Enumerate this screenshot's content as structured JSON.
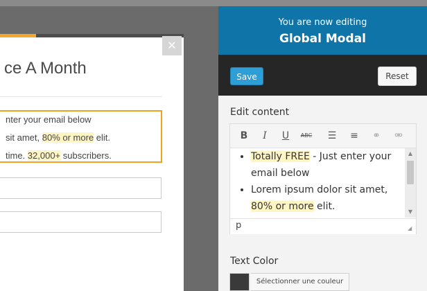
{
  "modal": {
    "title": "ce A Month",
    "close_glyph": "✕",
    "lines": [
      {
        "before": "nter your email below",
        "highlight": "",
        "after": ""
      },
      {
        "before": "sit amet, ",
        "highlight": "80% or more",
        "after": " elit."
      },
      {
        "before": "time. ",
        "highlight": "32,000+",
        "after": " subscribers."
      }
    ]
  },
  "panel": {
    "editing_label": "You are now editing",
    "editing_target": "Global Modal",
    "save_label": "Save",
    "reset_label": "Reset",
    "edit_content_label": "Edit content",
    "toolbar_icons": [
      "bold-icon",
      "italic-icon",
      "underline-icon",
      "strikethrough-icon",
      "bullet-list-icon",
      "numbered-list-icon",
      "link-icon",
      "unlink-icon"
    ],
    "toolbar_glyphs": [
      "B",
      "I",
      "U",
      "ABC",
      "☰",
      "≡",
      "⚭",
      "⚮"
    ],
    "editor_items": [
      {
        "highlight": "Totally FREE",
        "after": " - Just enter your email below"
      },
      {
        "before": "Lorem ipsum dolor sit amet, ",
        "highlight": "80% or more",
        "after": " elit."
      }
    ],
    "path": "p",
    "text_color_label": "Text Color",
    "text_color_value": "#3a3a3a",
    "color_button_label": "Sélectionner une couleur"
  },
  "colors": {
    "accent_orange": "#f0a21c",
    "header_blue": "#0f74a8",
    "save_blue": "#2d9ed6",
    "highlight": "#fff5c2"
  }
}
